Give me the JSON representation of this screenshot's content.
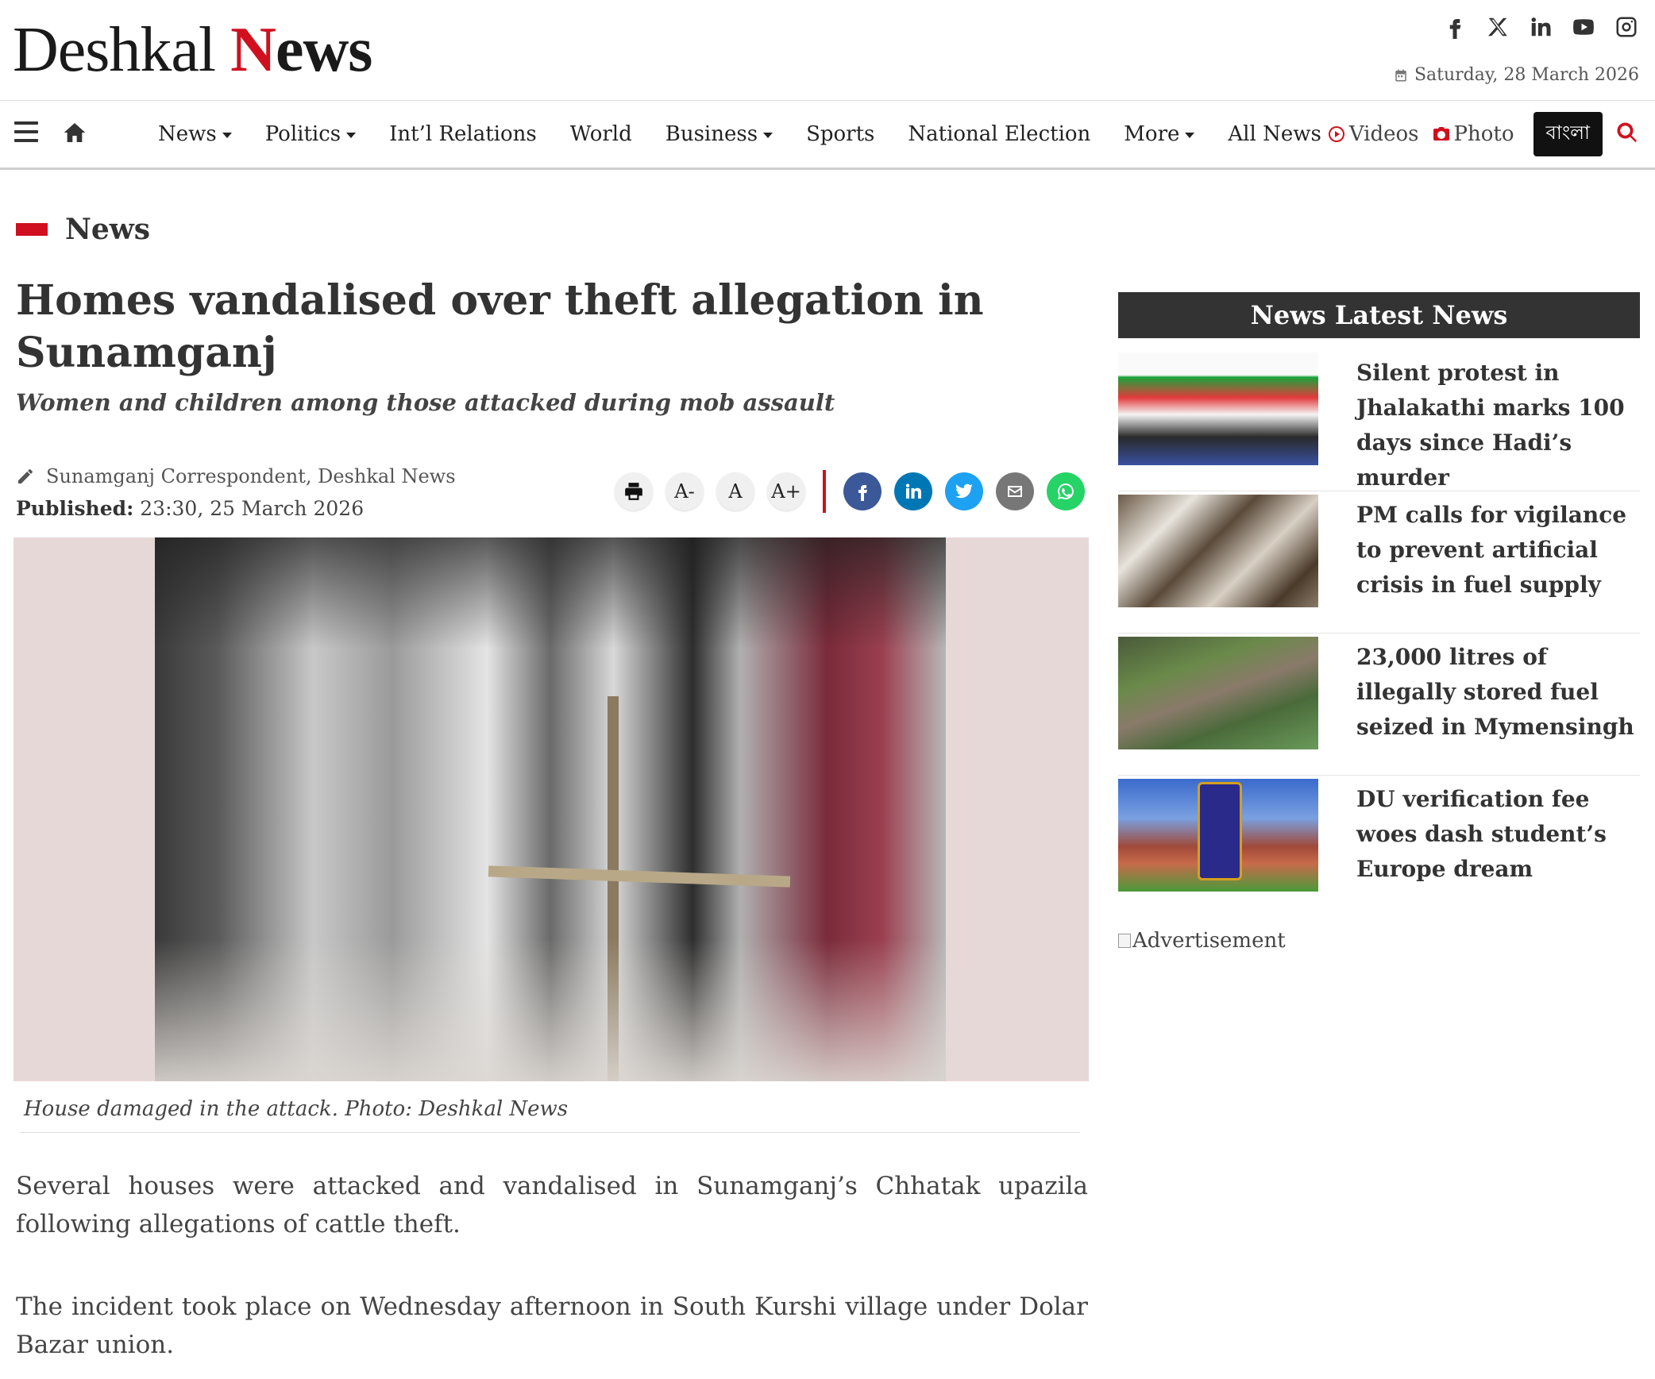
{
  "header": {
    "logo_part1": "Deshkal ",
    "logo_part2": "N",
    "logo_part3": "ews",
    "date": "Saturday, 28 March 2026",
    "social_icons": [
      "facebook-icon",
      "x-icon",
      "linkedin-icon",
      "youtube-icon",
      "instagram-icon"
    ]
  },
  "nav": {
    "items": [
      {
        "label": "News",
        "dropdown": true
      },
      {
        "label": "Politics",
        "dropdown": true
      },
      {
        "label": "Int’l Relations",
        "dropdown": false
      },
      {
        "label": "World",
        "dropdown": false
      },
      {
        "label": "Business",
        "dropdown": true
      },
      {
        "label": "Sports",
        "dropdown": false
      },
      {
        "label": "National Election",
        "dropdown": false
      },
      {
        "label": "More",
        "dropdown": true
      },
      {
        "label": "All News",
        "dropdown": false
      }
    ],
    "videos": "Videos",
    "photo": "Photo",
    "language": "বাংলা"
  },
  "section_label": "News",
  "article": {
    "headline": "Homes vandalised over theft allegation in Sunamganj",
    "subheadline": "Women and children among those attacked during mob assault",
    "author": "Sunamganj Correspondent, Deshkal News",
    "published_label": "Published:",
    "published_time": "23:30, 25 March 2026",
    "caption": "House damaged in the attack. Photo: Deshkal News",
    "paragraphs": [
      "Several houses were attacked and vandalised in Sunamganj’s Chhatak upazila following allegations of cattle theft.",
      "The incident took place on Wednesday afternoon in South Kurshi village under Dolar Bazar union."
    ]
  },
  "tools": {
    "font_decrease": "A-",
    "font_reset": "A",
    "font_increase": "A+"
  },
  "sidebar": {
    "heading": "News Latest News",
    "items": [
      {
        "title": "Silent protest in Jhalakathi marks 100 days since Hadi’s murder"
      },
      {
        "title": "PM calls for vigilance to prevent artificial crisis in fuel supply"
      },
      {
        "title": "23,000 litres of illegally stored fuel seized in Mymensingh"
      },
      {
        "title": "DU verification fee woes dash student’s Europe dream"
      }
    ],
    "ad_alt": "Advertisement"
  },
  "colors": {
    "accent": "#d0101e",
    "facebook": "#3b5998",
    "linkedin": "#0077b5",
    "twitter": "#1da1f2",
    "email": "#777777",
    "whatsapp": "#25d366"
  }
}
